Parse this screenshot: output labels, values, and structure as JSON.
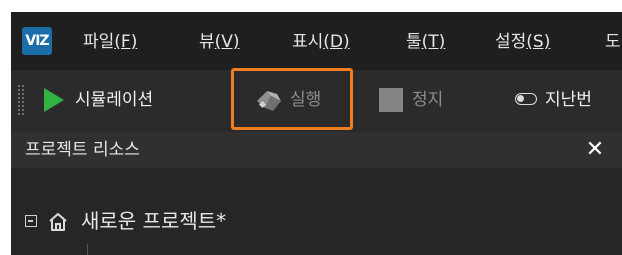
{
  "app": {
    "logo_text": "VIZ"
  },
  "menubar": {
    "items": [
      {
        "label": "파일",
        "mnemonic": "(F)"
      },
      {
        "label": "뷰",
        "mnemonic": "(V)"
      },
      {
        "label": "표시",
        "mnemonic": "(D)"
      },
      {
        "label": "툴",
        "mnemonic": "(T)"
      },
      {
        "label": "설정",
        "mnemonic": "(S)"
      },
      {
        "label": "도",
        "mnemonic": ""
      }
    ]
  },
  "toolbar": {
    "simulation": {
      "label": "시뮬레이션",
      "icon": "play-icon",
      "color": "#30b343"
    },
    "run": {
      "label": "실행",
      "icon": "robot-arm-icon",
      "disabled": true
    },
    "stop": {
      "label": "정지",
      "icon": "stop-icon",
      "disabled": true
    },
    "prev": {
      "label": "지난번",
      "icon": "toggle-icon"
    }
  },
  "highlight": {
    "color": "#ef7d22",
    "target": "run"
  },
  "panel": {
    "title": "프로젝트 리소스",
    "close_icon": "close-icon",
    "tree": {
      "root": {
        "label": "새로운 프로젝트*",
        "icon": "home-icon",
        "expanded": true
      }
    }
  }
}
